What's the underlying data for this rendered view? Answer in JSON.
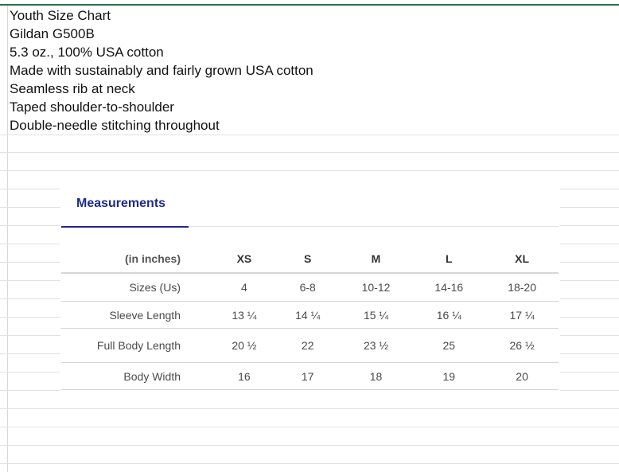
{
  "cells": [
    "Youth Size Chart",
    "Gildan G500B",
    "5.3 oz., 100% USA cotton",
    "Made with sustainably and fairly grown USA cotton",
    "Seamless rib at neck",
    "Taped shoulder-to-shoulder",
    "Double-needle stitching throughout"
  ],
  "measurements": {
    "tab_label": "Measurements",
    "unit_header": "(in inches)",
    "sizes": [
      "XS",
      "S",
      "M",
      "L",
      "XL"
    ],
    "rows": [
      {
        "label": "Sizes (Us)",
        "values": [
          "4",
          "6-8",
          "10-12",
          "14-16",
          "18-20"
        ]
      },
      {
        "label": "Sleeve Length",
        "values": [
          "13 ¼",
          "14 ¼",
          "15 ¼",
          "16 ¼",
          "17 ¼"
        ]
      },
      {
        "label": "Full Body Length",
        "values": [
          "20 ½",
          "22",
          "23 ½",
          "25",
          "26 ½"
        ]
      },
      {
        "label": "Body Width",
        "values": [
          "16",
          "17",
          "18",
          "19",
          "20"
        ]
      }
    ]
  }
}
